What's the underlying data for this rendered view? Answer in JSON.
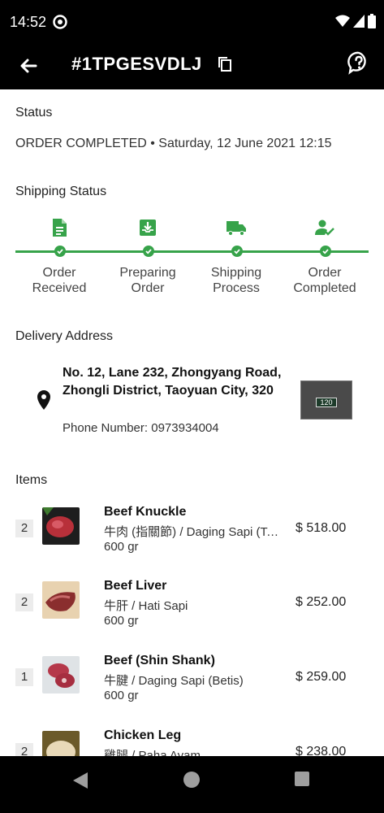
{
  "statusbar": {
    "time": "14:52"
  },
  "appbar": {
    "title": "#1TPGESVDLJ"
  },
  "status": {
    "title": "Status",
    "text": "ORDER COMPLETED • Saturday, 12 June 2021 12:15"
  },
  "shipping": {
    "title": "Shipping Status",
    "accent": "#37a34a",
    "steps": [
      {
        "label": "Order Received",
        "icon": "document-icon"
      },
      {
        "label": "Preparing Order",
        "icon": "inbox-download-icon"
      },
      {
        "label": "Shipping Process",
        "icon": "truck-icon"
      },
      {
        "label": "Order Completed",
        "icon": "user-check-icon"
      }
    ]
  },
  "delivery": {
    "title": "Delivery Address",
    "address": "No. 12, Lane 232, Zhongyang Road, Zhongli District, Taoyuan City, 320",
    "phone": "Phone Number: 0973934004",
    "image_text": "120"
  },
  "items": {
    "title": "Items",
    "list": [
      {
        "qty": "2",
        "name": "Beef Knuckle",
        "desc": "牛肉 (指關節) / Daging Sapi (Tempurung Lutut)",
        "weight": "600 gr",
        "price": "$ 518.00"
      },
      {
        "qty": "2",
        "name": "Beef Liver",
        "desc": "牛肝 / Hati Sapi",
        "weight": "600 gr",
        "price": "$ 252.00"
      },
      {
        "qty": "1",
        "name": "Beef (Shin Shank)",
        "desc": "牛腱 / Daging Sapi (Betis)",
        "weight": "600 gr",
        "price": "$ 259.00"
      },
      {
        "qty": "2",
        "name": "Chicken Leg",
        "desc": "雞腿 / Paha Ayam",
        "weight": "",
        "price": "$ 238.00"
      }
    ]
  }
}
